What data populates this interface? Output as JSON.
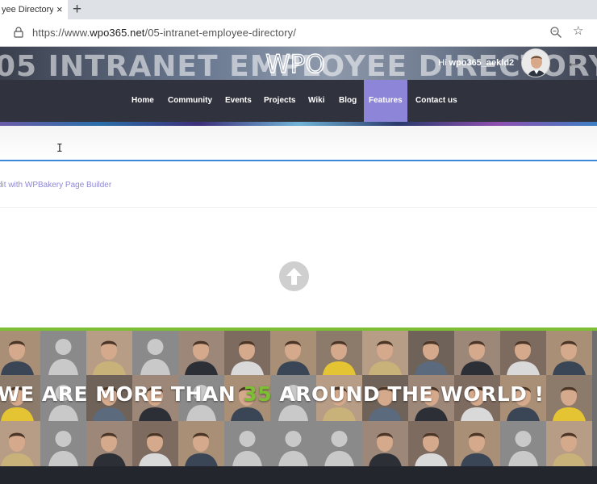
{
  "browser": {
    "tab_title": "yee Directory –",
    "tab_close": "×",
    "new_tab": "+",
    "url_prefix": "https://www.",
    "url_host": "wpo365.net",
    "url_path": "/05-intranet-employee-directory/",
    "icons": [
      "lock-icon",
      "zoom-icon",
      "star-icon"
    ]
  },
  "header": {
    "banner_text": "05 INTRANET EMPLOYEE DIRECTORY",
    "logo_text": "WPO",
    "greeting_prefix": "Hi ",
    "username": "wpo365_aekld2",
    "back_icon": "←"
  },
  "nav": {
    "items": [
      "Home",
      "Community",
      "Events",
      "Projects",
      "Wiki",
      "Blog",
      "Features",
      "Contact us"
    ],
    "active": "Features",
    "accent_color": "#8c85d8"
  },
  "editor": {
    "cursor_glyph": "I",
    "wpbakery_link": "dit with WPBakery Page Builder"
  },
  "employees": {
    "tagline_before": "WE ARE MORE THAN ",
    "tagline_number": "35",
    "tagline_after": " AROUND THE WORLD !",
    "accent_color": "#7cbf34"
  }
}
